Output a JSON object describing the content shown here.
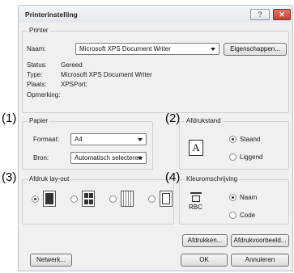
{
  "window": {
    "title": "Printerinstelling",
    "help_label": "?",
    "close_label": "✕"
  },
  "printer": {
    "group_label": "Printer",
    "name_label": "Naam:",
    "name_value": "Microsoft XPS Document Writer",
    "properties_button": "Eigenschappen...",
    "status_label": "Status:",
    "status_value": "Gereed",
    "type_label": "Type:",
    "type_value": "Microsoft XPS Document Writer",
    "location_label": "Plaats:",
    "location_value": "XPSPort:",
    "comment_label": "Opmerking:"
  },
  "markers": {
    "m1": "(1)",
    "m2": "(2)",
    "m3": "(3)",
    "m4": "(4)"
  },
  "paper": {
    "group_label": "Papier",
    "format_label": "Formaat:",
    "format_value": "A4",
    "source_label": "Bron:",
    "source_value": "Automatisch selecteren"
  },
  "orientation": {
    "group_label": "Afdrukstand",
    "options": [
      "Staand",
      "Liggend"
    ],
    "selected": "Staand",
    "icon_letter": "A"
  },
  "layout": {
    "group_label": "Afdruk lay-out",
    "selected_index": 0
  },
  "color": {
    "group_label": "Kleuromschrijving",
    "options": [
      "Naam",
      "Code"
    ],
    "selected": "Naam",
    "icon_text": "RBC"
  },
  "buttons": {
    "print": "Afdrukken...",
    "preview": "Afdrukvoorbeeld...",
    "network": "Netwerk...",
    "ok": "OK",
    "cancel": "Annuleren"
  }
}
